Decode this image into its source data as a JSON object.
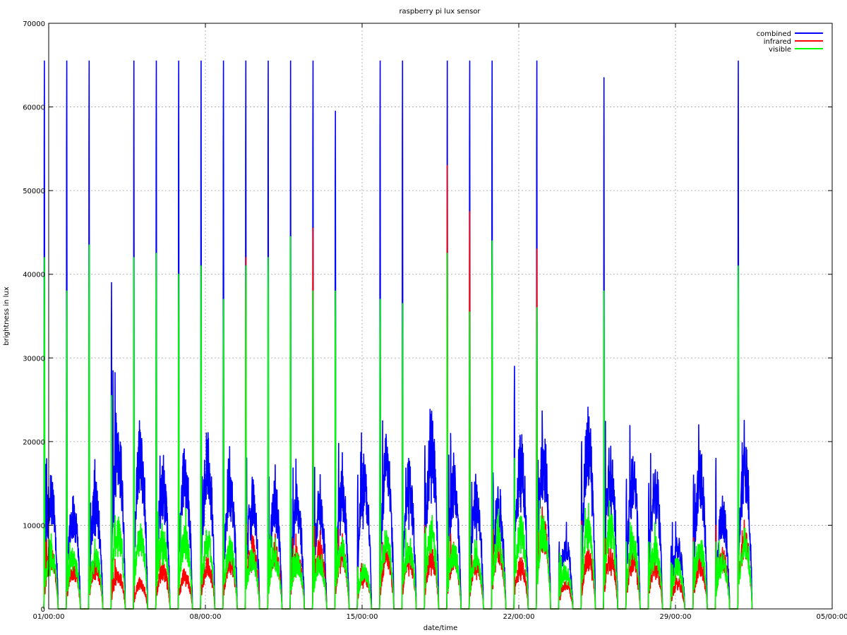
{
  "chart_data": {
    "type": "line",
    "title": "raspberry pi lux sensor",
    "xlabel": "date/time",
    "ylabel": "brightness in lux",
    "xlim": [
      1,
      36
    ],
    "ylim": [
      0,
      70000
    ],
    "grid": true,
    "legend_position": "top-right",
    "x_ticks": [
      {
        "value": 1,
        "label": "01/00:00"
      },
      {
        "value": 8,
        "label": "08/00:00"
      },
      {
        "value": 15,
        "label": "15/00:00"
      },
      {
        "value": 22,
        "label": "22/00:00"
      },
      {
        "value": 29,
        "label": "29/00:00"
      },
      {
        "value": 36,
        "label": "05/00:00"
      }
    ],
    "y_ticks": [
      0,
      10000,
      20000,
      30000,
      40000,
      50000,
      60000,
      70000
    ],
    "x_unit": "day of month (day 36 = 05 of next month)",
    "day_peaks": [
      {
        "day": 1,
        "combined": 65500,
        "infrared": 8000,
        "visible": 42000,
        "combined_base": 13000,
        "infrared_base": 6000,
        "visible_base": 6500
      },
      {
        "day": 2,
        "combined": 65500,
        "infrared": 6000,
        "visible": 38000,
        "combined_base": 11000,
        "infrared_base": 4500,
        "visible_base": 6000
      },
      {
        "day": 3,
        "combined": 65500,
        "infrared": 6500,
        "visible": 43500,
        "combined_base": 12500,
        "infrared_base": 5000,
        "visible_base": 6000
      },
      {
        "day": 4,
        "combined": 39000,
        "infrared": 9000,
        "visible": 25500,
        "combined_base": 19000,
        "infrared_base": 4000,
        "visible_base": 9000
      },
      {
        "day": 5,
        "combined": 65500,
        "infrared": 8000,
        "visible": 42000,
        "combined_base": 18000,
        "infrared_base": 3000,
        "visible_base": 8500
      },
      {
        "day": 6,
        "combined": 65500,
        "infrared": 8500,
        "visible": 42500,
        "combined_base": 14000,
        "infrared_base": 4500,
        "visible_base": 8000
      },
      {
        "day": 7,
        "combined": 65500,
        "infrared": 7500,
        "visible": 40000,
        "combined_base": 16000,
        "infrared_base": 4000,
        "visible_base": 8000
      },
      {
        "day": 8,
        "combined": 65500,
        "infrared": 9500,
        "visible": 41000,
        "combined_base": 17000,
        "infrared_base": 5000,
        "visible_base": 8000
      },
      {
        "day": 9,
        "combined": 65500,
        "infrared": 8000,
        "visible": 37000,
        "combined_base": 14000,
        "infrared_base": 5500,
        "visible_base": 7000
      },
      {
        "day": 10,
        "combined": 65500,
        "infrared": 42000,
        "visible": 41000,
        "combined_base": 12500,
        "infrared_base": 7000,
        "visible_base": 6000
      },
      {
        "day": 11,
        "combined": 65500,
        "infrared": 7000,
        "visible": 42000,
        "combined_base": 12500,
        "infrared_base": 6500,
        "visible_base": 6000
      },
      {
        "day": 12,
        "combined": 65500,
        "infrared": 7000,
        "visible": 44500,
        "combined_base": 12000,
        "infrared_base": 6000,
        "visible_base": 5500
      },
      {
        "day": 13,
        "combined": 65500,
        "infrared": 45500,
        "visible": 38000,
        "combined_base": 12000,
        "infrared_base": 7000,
        "visible_base": 5500
      },
      {
        "day": 14,
        "combined": 59500,
        "infrared": 7500,
        "visible": 38000,
        "combined_base": 13500,
        "infrared_base": 6500,
        "visible_base": 7000
      },
      {
        "day": 15,
        "combined": 16000,
        "infrared": 5000,
        "visible": 5000,
        "combined_base": 15500,
        "infrared_base": 4000,
        "visible_base": 4500
      },
      {
        "day": 16,
        "combined": 65500,
        "infrared": 10500,
        "visible": 37000,
        "combined_base": 17000,
        "infrared_base": 6000,
        "visible_base": 8000
      },
      {
        "day": 17,
        "combined": 65500,
        "infrared": 8000,
        "visible": 36500,
        "combined_base": 14500,
        "infrared_base": 6000,
        "visible_base": 7000
      },
      {
        "day": 18,
        "combined": 19500,
        "infrared": 10000,
        "visible": 9000,
        "combined_base": 19000,
        "infrared_base": 6000,
        "visible_base": 8500
      },
      {
        "day": 19,
        "combined": 65500,
        "infrared": 53000,
        "visible": 42500,
        "combined_base": 14000,
        "infrared_base": 6000,
        "visible_base": 6500
      },
      {
        "day": 20,
        "combined": 65500,
        "infrared": 47500,
        "visible": 35500,
        "combined_base": 13000,
        "infrared_base": 5500,
        "visible_base": 6000
      },
      {
        "day": 21,
        "combined": 65500,
        "infrared": 9500,
        "visible": 44000,
        "combined_base": 12000,
        "infrared_base": 7000,
        "visible_base": 8000
      },
      {
        "day": 22,
        "combined": 29000,
        "infrared": 9500,
        "visible": 18000,
        "combined_base": 17000,
        "infrared_base": 5000,
        "visible_base": 9000
      },
      {
        "day": 23,
        "combined": 65500,
        "infrared": 43000,
        "visible": 36000,
        "combined_base": 17500,
        "infrared_base": 9000,
        "visible_base": 9000
      },
      {
        "day": 24,
        "combined": 8000,
        "infrared": 4000,
        "visible": 5500,
        "combined_base": 7500,
        "infrared_base": 3000,
        "visible_base": 4500
      },
      {
        "day": 25,
        "combined": 20000,
        "infrared": 10500,
        "visible": 10000,
        "combined_base": 19500,
        "infrared_base": 6000,
        "visible_base": 9000
      },
      {
        "day": 26,
        "combined": 63500,
        "infrared": 11000,
        "visible": 38000,
        "combined_base": 16000,
        "infrared_base": 6000,
        "visible_base": 9500
      },
      {
        "day": 27,
        "combined": 15500,
        "infrared": 7000,
        "visible": 8000,
        "combined_base": 15000,
        "infrared_base": 5500,
        "visible_base": 7500
      },
      {
        "day": 28,
        "combined": 15000,
        "infrared": 7500,
        "visible": 8000,
        "combined_base": 14500,
        "infrared_base": 5000,
        "visible_base": 7000
      },
      {
        "day": 29,
        "combined": 7500,
        "infrared": 3500,
        "visible": 5500,
        "combined_base": 7000,
        "infrared_base": 3000,
        "visible_base": 5000
      },
      {
        "day": 30,
        "combined": 16000,
        "infrared": 8500,
        "visible": 8000,
        "combined_base": 15500,
        "infrared_base": 5000,
        "visible_base": 7000
      },
      {
        "day": 31,
        "combined": 18000,
        "infrared": 10000,
        "visible": 8000,
        "combined_base": 11000,
        "infrared_base": 6000,
        "visible_base": 5500
      },
      {
        "day": 32,
        "combined": 65500,
        "infrared": 10500,
        "visible": 41000,
        "combined_base": 17000,
        "infrared_base": 8000,
        "visible_base": 8000
      }
    ],
    "series": [
      {
        "name": "combined",
        "color": "#0000ff"
      },
      {
        "name": "infrared",
        "color": "#ff0000"
      },
      {
        "name": "visible",
        "color": "#00ff00"
      }
    ]
  }
}
